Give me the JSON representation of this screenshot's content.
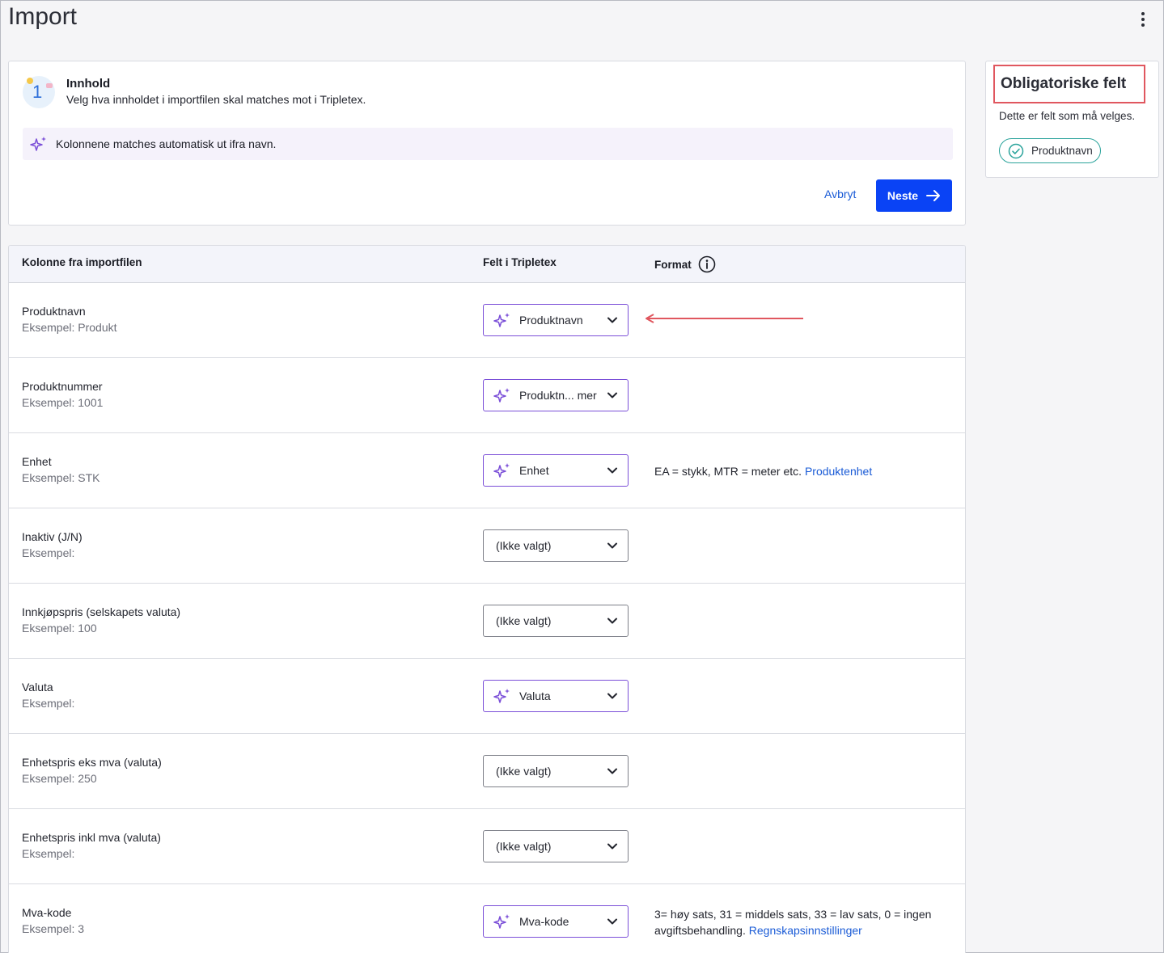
{
  "page": {
    "title": "Import"
  },
  "step": {
    "number": "1",
    "title": "Innhold",
    "description": "Velg hva innholdet i importfilen skal matches mot i Tripletex.",
    "ai_banner": "Kolonnene matches automatisk ut ifra navn.",
    "cancel_label": "Avbryt",
    "next_label": "Neste"
  },
  "required": {
    "title": "Obligatoriske felt",
    "description": "Dette er felt som må velges.",
    "chip": "Produktnavn"
  },
  "table": {
    "headers": {
      "column": "Kolonne fra importfilen",
      "field": "Felt i Tripletex",
      "format": "Format"
    },
    "rows": [
      {
        "name": "Produktnavn",
        "example": "Eksempel: Produkt",
        "field": "Produktnavn",
        "ai": true,
        "format": "",
        "link": ""
      },
      {
        "name": "Produktnummer",
        "example": "Eksempel: 1001",
        "field": "Produktn... mer",
        "ai": true,
        "format": "",
        "link": ""
      },
      {
        "name": "Enhet",
        "example": "Eksempel: STK",
        "field": "Enhet",
        "ai": true,
        "format": "EA = stykk, MTR = meter etc. ",
        "link": "Produktenhet"
      },
      {
        "name": "Inaktiv (J/N)",
        "example": "Eksempel:",
        "field": "(Ikke valgt)",
        "ai": false,
        "format": "",
        "link": ""
      },
      {
        "name": "Innkjøpspris (selskapets valuta)",
        "example": "Eksempel: 100",
        "field": "(Ikke valgt)",
        "ai": false,
        "format": "",
        "link": ""
      },
      {
        "name": "Valuta",
        "example": "Eksempel:",
        "field": "Valuta",
        "ai": true,
        "format": "",
        "link": ""
      },
      {
        "name": "Enhetspris eks mva (valuta)",
        "example": "Eksempel: 250",
        "field": "(Ikke valgt)",
        "ai": false,
        "format": "",
        "link": ""
      },
      {
        "name": "Enhetspris inkl mva (valuta)",
        "example": "Eksempel:",
        "field": "(Ikke valgt)",
        "ai": false,
        "format": "",
        "link": ""
      },
      {
        "name": "Mva-kode",
        "example": "Eksempel: 3",
        "field": "Mva-kode",
        "ai": true,
        "format": "3= høy sats, 31 = middels sats, 33 = lav sats, 0 = ingen avgiftsbehandling. ",
        "link": "Regnskapsinnstillinger"
      }
    ]
  },
  "colors": {
    "primary": "#0a43f5",
    "ai_purple": "#7b4fd8",
    "highlight": "#e0575f",
    "teal": "#2aa39b",
    "link": "#1a5bd6"
  },
  "icons": {
    "more": "more-vertical-icon",
    "sparkle": "sparkle-icon",
    "arrow_right": "arrow-right-icon",
    "check": "check-circle-icon",
    "info": "info-icon",
    "chevron": "chevron-down-icon"
  }
}
